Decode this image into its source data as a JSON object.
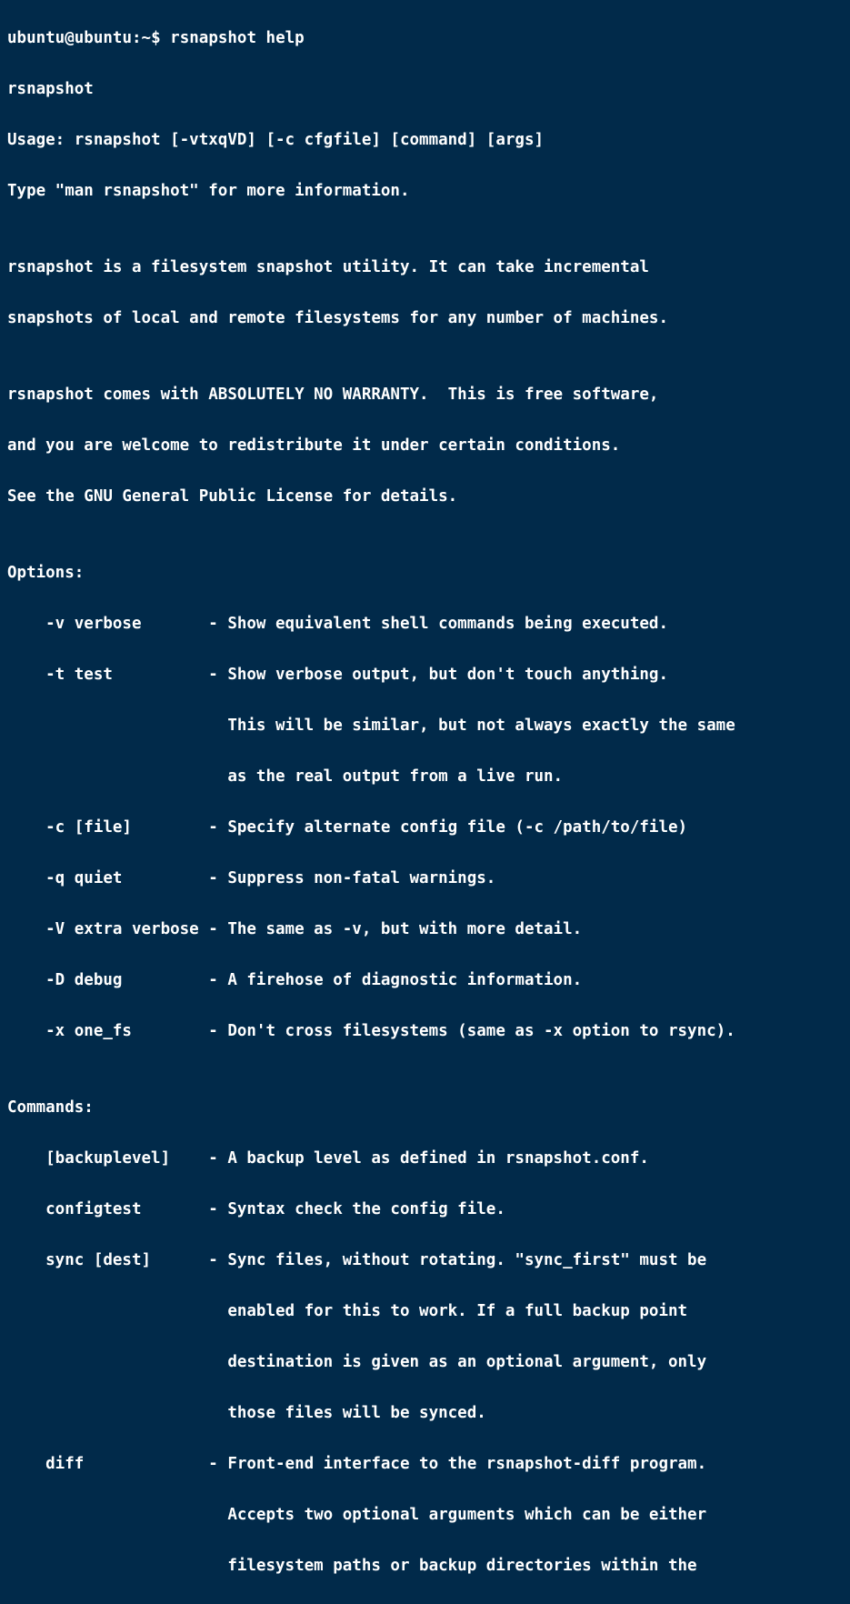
{
  "prompt": {
    "user": "ubuntu",
    "at": "@",
    "host": "ubuntu",
    "colon": ":",
    "path": "~",
    "dollar": "$",
    "space": " ",
    "command": "rsnapshot help"
  },
  "lines": {
    "l01": "rsnapshot",
    "l02": "Usage: rsnapshot [-vtxqVD] [-c cfgfile] [command] [args]",
    "l03": "Type \"man rsnapshot\" for more information.",
    "l04": "",
    "l05": "rsnapshot is a filesystem snapshot utility. It can take incremental",
    "l06": "snapshots of local and remote filesystems for any number of machines.",
    "l07": "",
    "l08": "rsnapshot comes with ABSOLUTELY NO WARRANTY.  This is free software,",
    "l09": "and you are welcome to redistribute it under certain conditions.",
    "l10": "See the GNU General Public License for details.",
    "l11": "",
    "l12": "Options:",
    "l13": "    -v verbose       - Show equivalent shell commands being executed.",
    "l14": "    -t test          - Show verbose output, but don't touch anything.",
    "l15": "                       This will be similar, but not always exactly the same",
    "l16": "                       as the real output from a live run.",
    "l17": "    -c [file]        - Specify alternate config file (-c /path/to/file)",
    "l18": "    -q quiet         - Suppress non-fatal warnings.",
    "l19": "    -V extra verbose - The same as -v, but with more detail.",
    "l20": "    -D debug         - A firehose of diagnostic information.",
    "l21": "    -x one_fs        - Don't cross filesystems (same as -x option to rsync).",
    "l22": "",
    "l23": "Commands:",
    "l24": "    [backuplevel]    - A backup level as defined in rsnapshot.conf.",
    "l25": "    configtest       - Syntax check the config file.",
    "l26": "    sync [dest]      - Sync files, without rotating. \"sync_first\" must be",
    "l27": "                       enabled for this to work. If a full backup point",
    "l28": "                       destination is given as an optional argument, only",
    "l29": "                       those files will be synced.",
    "l30": "    diff             - Front-end interface to the rsnapshot-diff program.",
    "l31": "                       Accepts two optional arguments which can be either",
    "l32": "                       filesystem paths or backup directories within the"
  }
}
